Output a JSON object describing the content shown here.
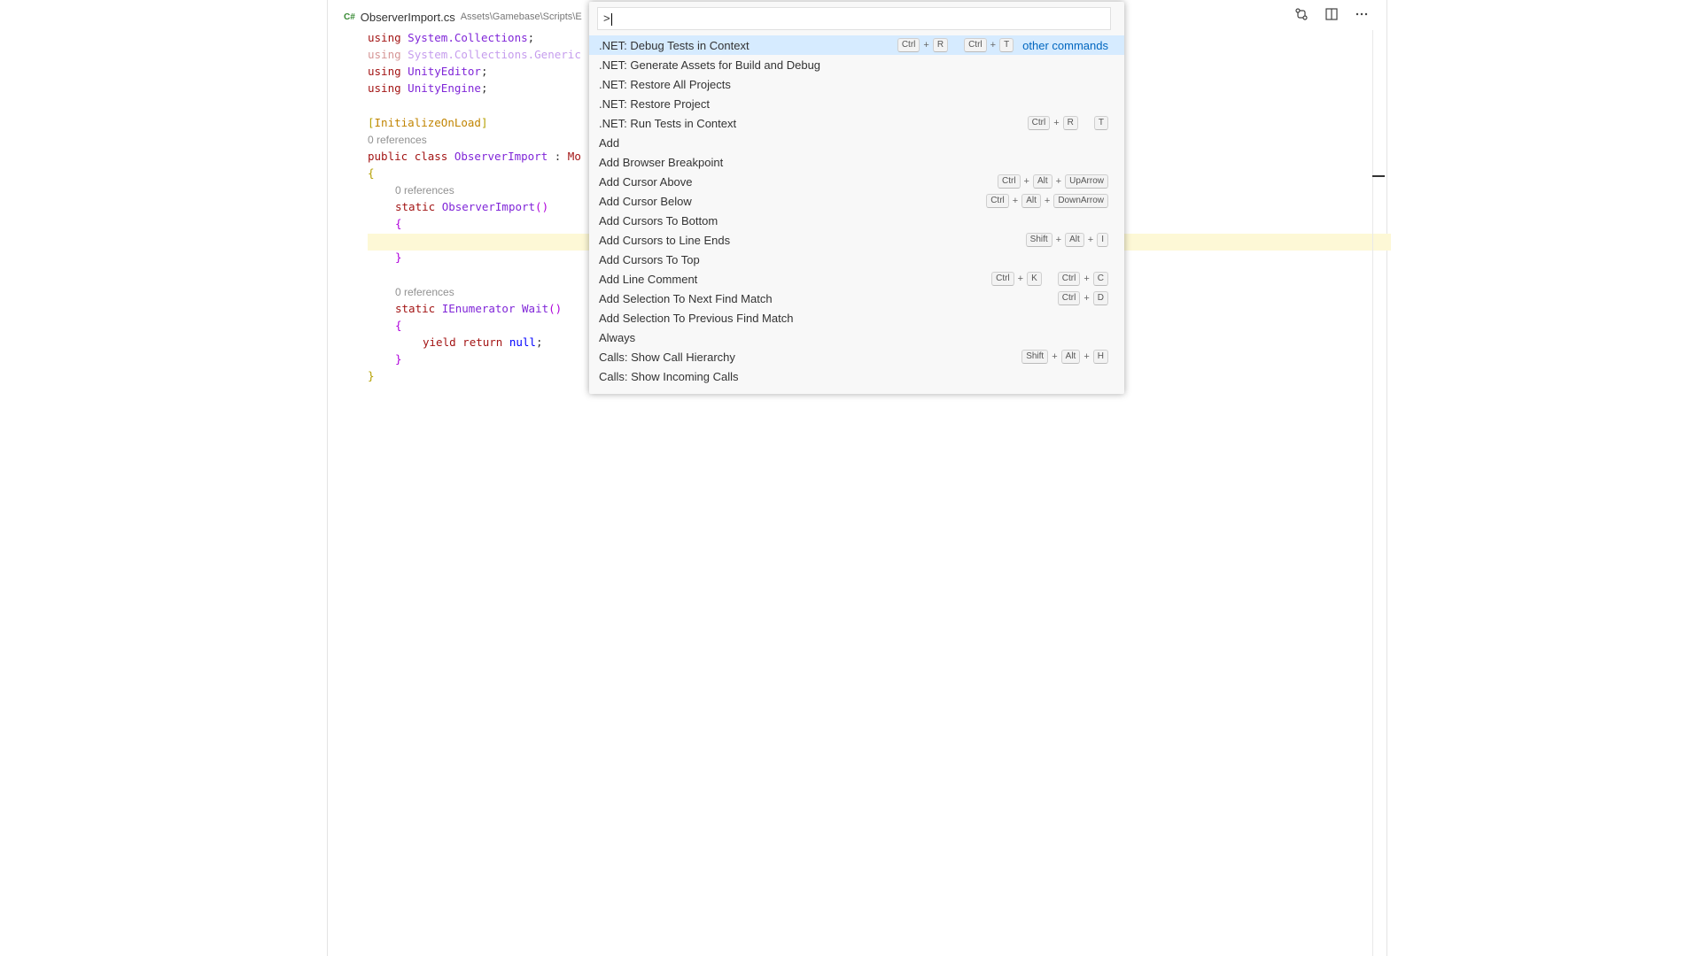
{
  "tab": {
    "icon": "C#",
    "filename": "ObserverImport.cs",
    "path": "Assets\\Gamebase\\Scripts\\E"
  },
  "editor_actions": [
    "open-changes-icon",
    "split-editor-icon",
    "more-actions-icon"
  ],
  "code": {
    "l1_kw": "using",
    "l1_ns": "System.Collections",
    "l1_end": ";",
    "l2_kw": "using",
    "l2_ns": "System.Collections.Generic",
    "l3_kw": "using",
    "l3_ns": "UnityEditor",
    "l3_end": ";",
    "l4_kw": "using",
    "l4_ns": "UnityEngine",
    "l4_end": ";",
    "l6_open": "[",
    "l6_attr": "InitializeOnLoad",
    "l6_close": "]",
    "lens1": "0 references",
    "l7_pub": "public",
    "l7_class": "class",
    "l7_name": "ObserverImport",
    "l7_colon": " : ",
    "l7_base": "Mo",
    "l8_brace": "{",
    "lens2": "0 references",
    "l9_static": "static",
    "l9_name": "ObserverImport",
    "l9_parens": "()",
    "l10_brace": "{",
    "l12_brace": "}",
    "lens3": "0 references",
    "l14_static": "static",
    "l14_type": "IEnumerator",
    "l14_name": "Wait",
    "l14_parens": "()",
    "l15_brace": "{",
    "l16_yield": "yield",
    "l16_return": "return",
    "l16_null": "null",
    "l16_end": ";",
    "l17_brace": "}",
    "l18_brace": "}"
  },
  "palette": {
    "input_value": ">",
    "other_commands": "other commands",
    "items": [
      {
        "label": ".NET: Debug Tests in Context",
        "keys": [
          [
            "Ctrl",
            "R"
          ],
          [
            "Ctrl",
            "T"
          ]
        ]
      },
      {
        "label": ".NET: Generate Assets for Build and Debug",
        "keys": []
      },
      {
        "label": ".NET: Restore All Projects",
        "keys": []
      },
      {
        "label": ".NET: Restore Project",
        "keys": []
      },
      {
        "label": ".NET: Run Tests in Context",
        "keys": [
          [
            "Ctrl",
            "R"
          ],
          [
            "T"
          ]
        ]
      },
      {
        "label": "Add",
        "keys": []
      },
      {
        "label": "Add Browser Breakpoint",
        "keys": []
      },
      {
        "label": "Add Cursor Above",
        "keys": [
          [
            "Ctrl",
            "Alt",
            "UpArrow"
          ]
        ]
      },
      {
        "label": "Add Cursor Below",
        "keys": [
          [
            "Ctrl",
            "Alt",
            "DownArrow"
          ]
        ]
      },
      {
        "label": "Add Cursors To Bottom",
        "keys": []
      },
      {
        "label": "Add Cursors to Line Ends",
        "keys": [
          [
            "Shift",
            "Alt",
            "I"
          ]
        ]
      },
      {
        "label": "Add Cursors To Top",
        "keys": []
      },
      {
        "label": "Add Line Comment",
        "keys": [
          [
            "Ctrl",
            "K"
          ],
          [
            "Ctrl",
            "C"
          ]
        ]
      },
      {
        "label": "Add Selection To Next Find Match",
        "keys": [
          [
            "Ctrl",
            "D"
          ]
        ]
      },
      {
        "label": "Add Selection To Previous Find Match",
        "keys": []
      },
      {
        "label": "Always",
        "keys": []
      },
      {
        "label": "Calls: Show Call Hierarchy",
        "keys": [
          [
            "Shift",
            "Alt",
            "H"
          ]
        ]
      },
      {
        "label": "Calls: Show Incoming Calls",
        "keys": []
      }
    ]
  }
}
